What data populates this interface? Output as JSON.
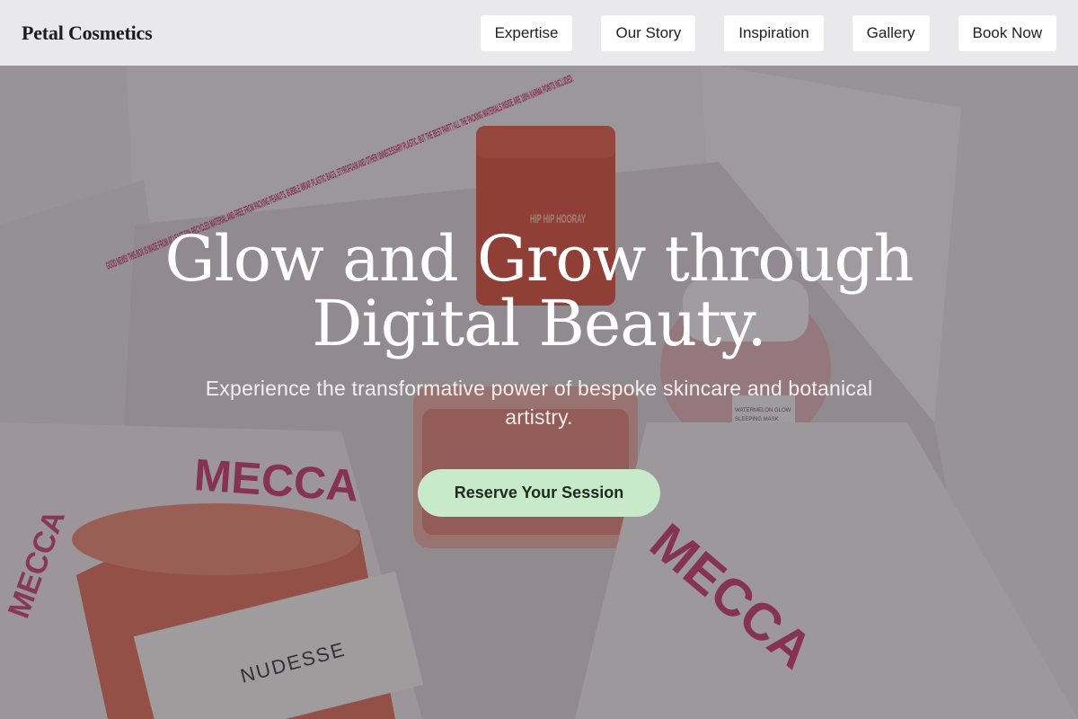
{
  "header": {
    "brand": "Petal Cosmetics",
    "nav": [
      {
        "label": "Expertise"
      },
      {
        "label": "Our Story"
      },
      {
        "label": "Inspiration"
      },
      {
        "label": "Gallery"
      },
      {
        "label": "Book Now"
      }
    ]
  },
  "hero": {
    "headline": "Glow and Grow through Digital Beauty.",
    "subline": "Experience the transformative power of bespoke skincare and botanical artistry.",
    "cta_label": "Reserve Your Session",
    "photo_text": {
      "box_note": "GOOD NEWS! THIS BOX IS MADE FROM AT LEAST 50% RECYCLED MATERIAL AND FREE FROM PACKING PEANUTS, BUBBLE WRAP, PLASTIC BAGS, STYROFOAM AND OTHER UNNECESSARY PLASTIC. BUT THE BEST PART? ALL THE PACKING MATERIALS INSIDE ARE 100% KARMA POINTS INCLUDED.",
      "brand_print": "MECCA",
      "product_tube": "HIP HIP HOORAY",
      "product_candle": "NUDESSE",
      "product_jar_1": "WATERMELON GLOW",
      "product_jar_2": "SLEEPING MASK"
    }
  },
  "colors": {
    "cta_bg": "#c9e9cb",
    "nav_bg": "#ffffff",
    "header_bg": "#ecebed",
    "overlay": "#28242c"
  }
}
